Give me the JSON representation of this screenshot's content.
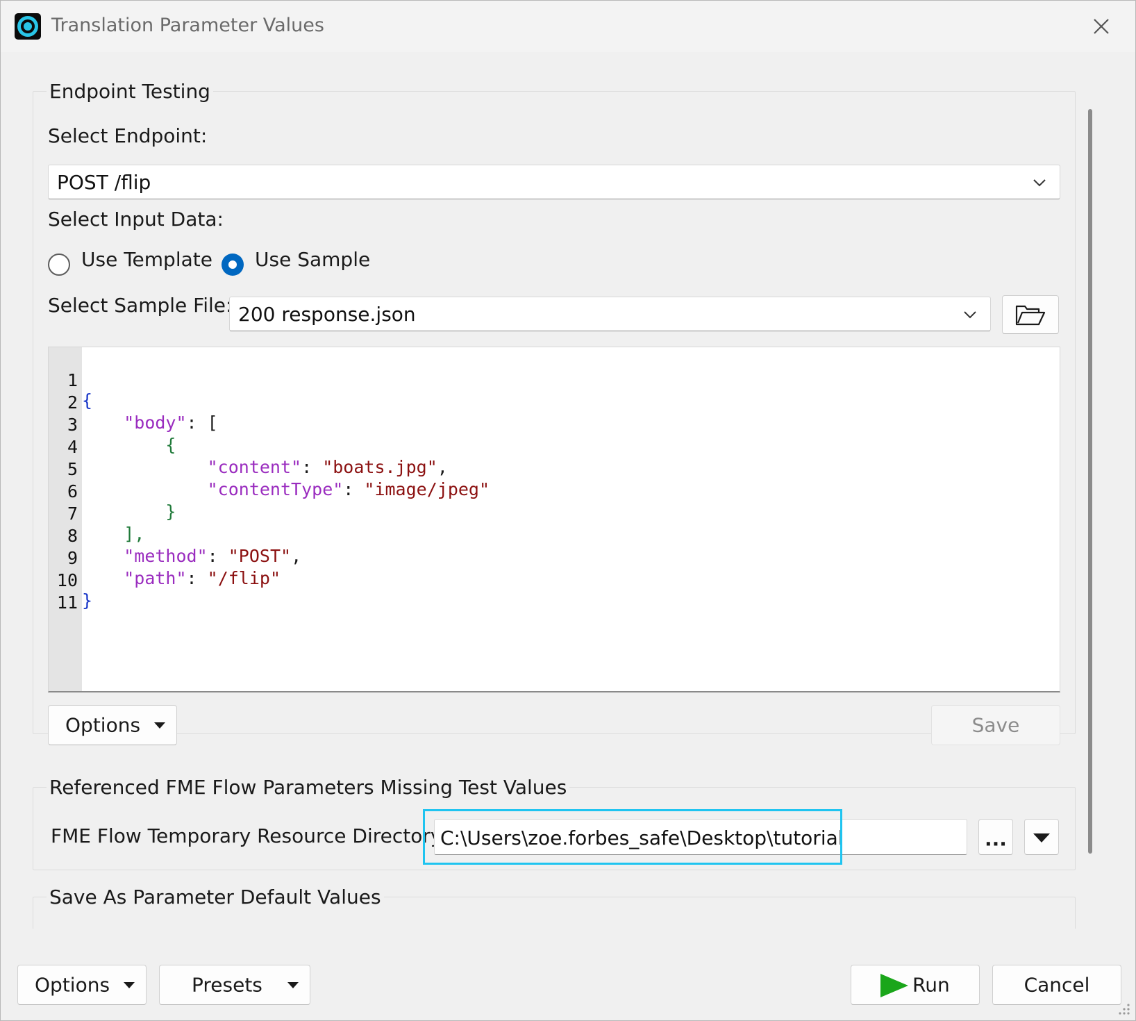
{
  "window": {
    "title": "Translation Parameter Values"
  },
  "endpoint_testing": {
    "group_title": "Endpoint Testing",
    "select_endpoint_label": "Select Endpoint:",
    "endpoint_value": "POST /flip",
    "select_input_label": "Select Input Data:",
    "radio_template_label": "Use Template",
    "radio_sample_label": "Use Sample",
    "selected_input": "Use Sample",
    "select_sample_label": "Select Sample File:",
    "sample_file_value": "200 response.json",
    "code_lines": [
      {
        "n": "1"
      },
      {
        "n": "2"
      },
      {
        "n": "3"
      },
      {
        "n": "4"
      },
      {
        "n": "5"
      },
      {
        "n": "6"
      },
      {
        "n": "7"
      },
      {
        "n": "8"
      },
      {
        "n": "9"
      },
      {
        "n": "10"
      },
      {
        "n": "11"
      }
    ],
    "code_tokens": {
      "l1_brace": "{",
      "l2_key": "\"body\"",
      "l2_rest": ": [",
      "l3_brace": "{",
      "l4_key": "\"content\"",
      "l4_colon": ": ",
      "l4_val": "\"boats.jpg\"",
      "l4_comma": ",",
      "l5_key": "\"contentType\"",
      "l5_colon": ": ",
      "l5_val": "\"image/jpeg\"",
      "l6_brace": "}",
      "l7_bracket": "],",
      "l8_key": "\"method\"",
      "l8_colon": ": ",
      "l8_val": "\"POST\"",
      "l8_comma": ",",
      "l9_key": "\"path\"",
      "l9_colon": ": ",
      "l9_val": "\"/flip\"",
      "l10_brace": "}"
    },
    "options_label": "Options",
    "save_label": "Save"
  },
  "missing_params": {
    "group_title": "Referenced FME Flow Parameters Missing Test Values",
    "temp_dir_label": "FME Flow Temporary Resource Directory:",
    "temp_dir_value": "C:\\Users\\zoe.forbes_safe\\Desktop\\tutorial",
    "browse_label": "..."
  },
  "save_defaults": {
    "group_title": "Save As Parameter Default Values"
  },
  "footer": {
    "options_label": "Options",
    "presets_label": "Presets",
    "run_label": "Run",
    "cancel_label": "Cancel"
  },
  "colors": {
    "accent": "#0067c0",
    "highlight": "#1fc4f0",
    "run_icon": "#1aa61a"
  }
}
